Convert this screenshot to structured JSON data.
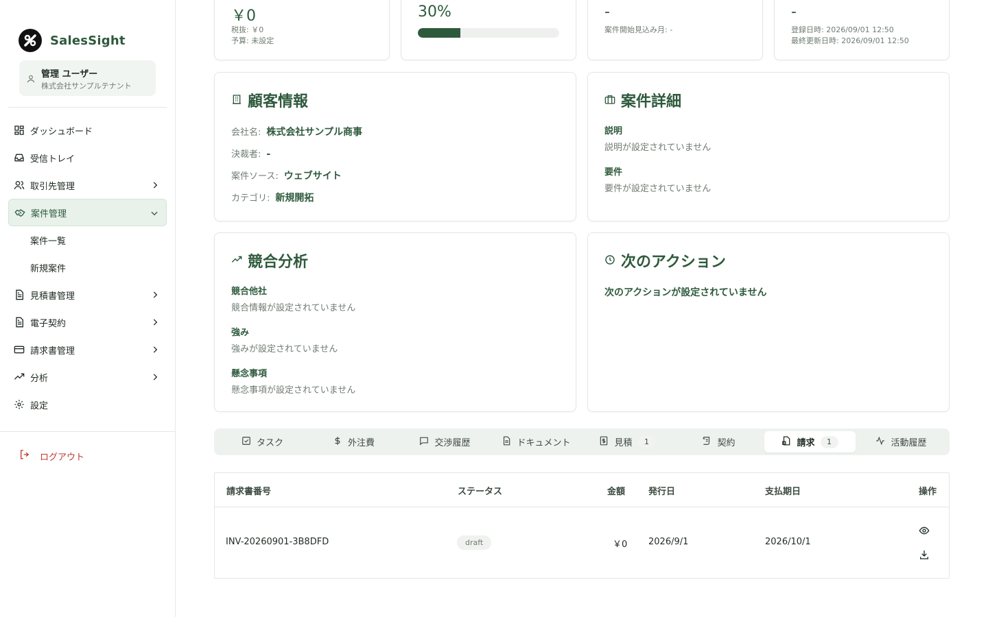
{
  "app": {
    "name": "SalesSight"
  },
  "user": {
    "name": "管理 ユーザー",
    "tenant": "株式会社サンプルテナント"
  },
  "nav": {
    "items": [
      {
        "label": "ダッシュボード"
      },
      {
        "label": "受信トレイ"
      },
      {
        "label": "取引先管理"
      },
      {
        "label": "案件管理"
      },
      {
        "label": "案件一覧"
      },
      {
        "label": "新規案件"
      },
      {
        "label": "見積書管理"
      },
      {
        "label": "電子契約"
      },
      {
        "label": "請求書管理"
      },
      {
        "label": "分析"
      },
      {
        "label": "設定"
      }
    ],
    "logout": "ログアウト"
  },
  "stats": {
    "amount": {
      "value": "￥0",
      "tax": "税抜: ￥0",
      "budget": "予算: 未設定"
    },
    "probability": {
      "value": "30%",
      "percent": 30
    },
    "start": {
      "value": "-",
      "sub": "案件開始見込み月: -"
    },
    "dates": {
      "value": "-",
      "created": "登録日時: 2026/09/01 12:50",
      "updated": "最終更新日時: 2026/09/01 12:50"
    }
  },
  "customer": {
    "title": "顧客情報",
    "company_k": "会社名:",
    "company_v": "株式会社サンプル商事",
    "decision_k": "決裁者:",
    "decision_v": "-",
    "source_k": "案件ソース:",
    "source_v": "ウェブサイト",
    "category_k": "カテゴリ:",
    "category_v": "新規開拓"
  },
  "detail": {
    "title": "案件詳細",
    "desc_label": "説明",
    "desc_value": "説明が設定されていません",
    "req_label": "要件",
    "req_value": "要件が設定されていません"
  },
  "competition": {
    "title": "競合分析",
    "comp_label": "競合他社",
    "comp_value": "競合情報が設定されていません",
    "strength_label": "強み",
    "strength_value": "強みが設定されていません",
    "concern_label": "懸念事項",
    "concern_value": "懸念事項が設定されていません"
  },
  "next_action": {
    "title": "次のアクション",
    "text": "次のアクションが設定されていません"
  },
  "tabs": {
    "task": "タスク",
    "outsource": "外注費",
    "negotiation": "交渉履歴",
    "document": "ドキュメント",
    "estimate": "見積",
    "estimate_count": "1",
    "contract": "契約",
    "invoice": "請求",
    "invoice_count": "1",
    "activity": "活動履歴"
  },
  "invoice_table": {
    "headers": {
      "number": "請求書番号",
      "status": "ステータス",
      "amount": "金額",
      "issued": "発行日",
      "due": "支払期日",
      "actions": "操作"
    },
    "rows": [
      {
        "number": "INV-20260901-3B8DFD",
        "status": "draft",
        "amount": "￥0",
        "issued": "2026/9/1",
        "due": "2026/10/1"
      }
    ]
  },
  "colors": {
    "accent": "#2e5a3c",
    "danger": "#c0392b",
    "muted": "#6f7c72"
  },
  "icons": [
    "logo-icon",
    "user-icon",
    "dashboard-icon",
    "inbox-icon",
    "contacts-icon",
    "handshake-icon",
    "document-icon",
    "card-icon",
    "trend-icon",
    "gear-icon",
    "logout-icon",
    "building-icon",
    "briefcase-icon",
    "clock-icon",
    "check-square-icon",
    "dollar-icon",
    "chat-icon",
    "invoice-icon",
    "scroll-icon",
    "activity-icon",
    "eye-icon",
    "download-icon",
    "chevron-right-icon",
    "chevron-down-icon"
  ]
}
